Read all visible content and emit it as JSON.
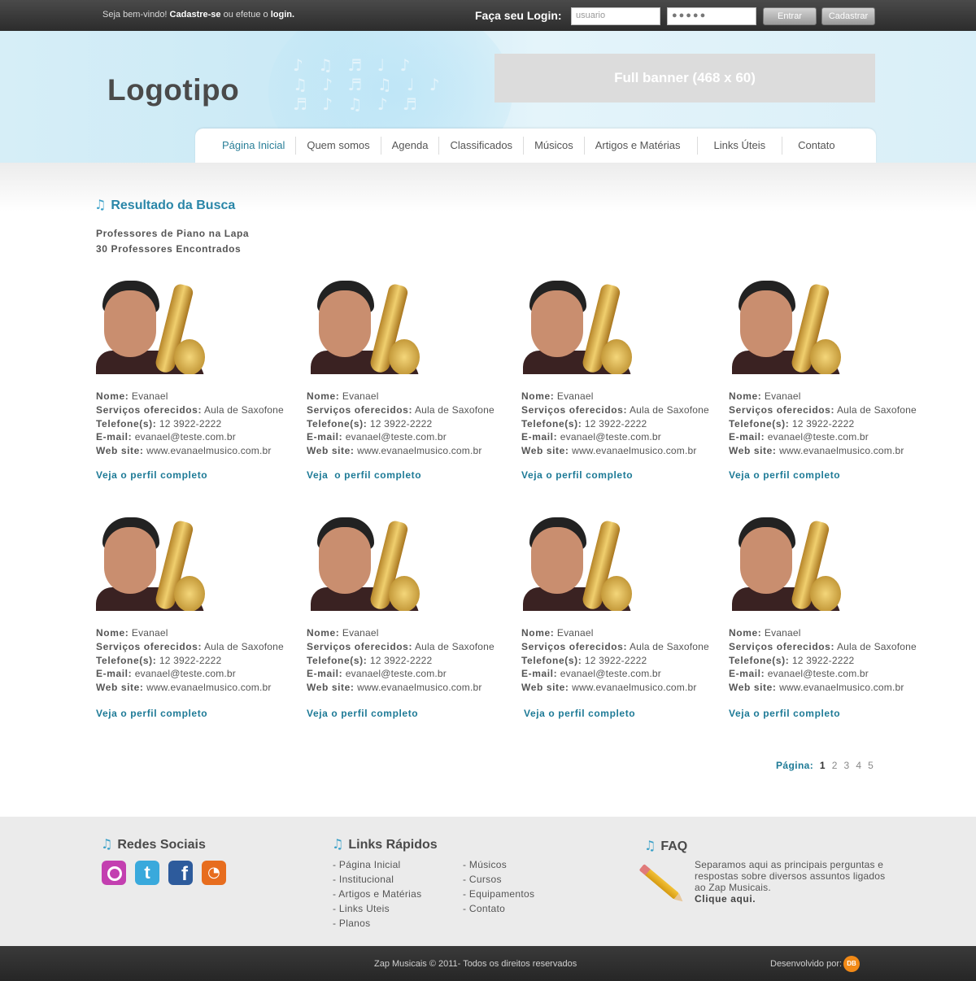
{
  "topbar": {
    "welcome_prefix": "Seja bem-vindo! ",
    "register_link": "Cadastre-se",
    "welcome_middle": " ou efetue o ",
    "login_link": "login.",
    "login_label": "Faça seu Login:",
    "username_placeholder": "usuario",
    "password_value": "●●●●●",
    "enter_button": "Entrar",
    "register_button": "Cadastrar"
  },
  "header": {
    "logo": "Logotipo",
    "banner": "Full banner (468 x 60)"
  },
  "nav": {
    "items": [
      "Página Inicial",
      "Quem somos",
      "Agenda",
      "Classificados",
      "Músicos",
      "Artigos e Matérias",
      "Links Úteis",
      "Contato"
    ],
    "active": "Página Inicial"
  },
  "search": {
    "title": "Resultado da Busca",
    "query_line": "Professores de Piano na Lapa",
    "count_line": "30 Professores Encontrados"
  },
  "labels": {
    "name": "Nome:",
    "services": "Serviços oferecidos:",
    "phone": "Telefone(s):",
    "email": "E-mail:",
    "website": "Web site:"
  },
  "results": [
    {
      "name": "Evanael",
      "services": "Aula de Saxofone",
      "phone": "12 3922-2222",
      "email": "evanael@teste.com.br",
      "website": "www.evanaelmusico.com.br",
      "link": "Veja o perfil completo"
    },
    {
      "name": "Evanael",
      "services": "Aula de Saxofone",
      "phone": "12 3922-2222",
      "email": "evanael@teste.com.br",
      "website": "www.evanaelmusico.com.br",
      "link": "Veja  o perfil completo"
    },
    {
      "name": "Evanael",
      "services": "Aula de Saxofone",
      "phone": "12 3922-2222",
      "email": "evanael@teste.com.br",
      "website": "www.evanaelmusico.com.br",
      "link": "Veja o perfil completo"
    },
    {
      "name": "Evanael",
      "services": "Aula de Saxofone",
      "phone": "12 3922-2222",
      "email": "evanael@teste.com.br",
      "website": "www.evanaelmusico.com.br",
      "link": "Veja o perfil completo"
    },
    {
      "name": "Evanael",
      "services": "Aula de Saxofone",
      "phone": "12 3922-2222",
      "email": "evanael@teste.com.br",
      "website": "www.evanaelmusico.com.br",
      "link": "Veja o perfil completo"
    },
    {
      "name": "Evanael",
      "services": "Aula de Saxofone",
      "phone": "12 3922-2222",
      "email": "evanael@teste.com.br",
      "website": "www.evanaelmusico.com.br",
      "link": "Veja o perfil completo"
    },
    {
      "name": "Evanael",
      "services": "Aula de Saxofone",
      "phone": "12 3922-2222",
      "email": "evanael@teste.com.br",
      "website": "www.evanaelmusico.com.br",
      "link": "Veja o perfil completo"
    },
    {
      "name": "Evanael",
      "services": "Aula de Saxofone",
      "phone": "12 3922-2222",
      "email": "evanael@teste.com.br",
      "website": "www.evanaelmusico.com.br",
      "link": "Veja o perfil completo"
    }
  ],
  "pagination": {
    "label": "Página:",
    "current": "1",
    "pages": [
      "2",
      "3",
      "4",
      "5"
    ]
  },
  "footer": {
    "social_title": "Redes Sociais",
    "social_icons": [
      "orkut-icon",
      "twitter-icon",
      "facebook-icon",
      "rss-icon"
    ],
    "links_title": "Links Rápidos",
    "links_col1": [
      "- Página Inicial",
      "- Institucional",
      "- Artigos e Matérias",
      "- Links Uteis",
      "- Planos"
    ],
    "links_col2": [
      "- Músicos",
      "- Cursos",
      "- Equipamentos",
      "- Contato"
    ],
    "faq_title": "FAQ",
    "faq_text": "Separamos aqui as principais perguntas e respostas sobre diversos assuntos ligados ao Zap Musicais.",
    "faq_link": "Clique aqui.",
    "copyright": "Zap Musicais © 2011- Todos os direitos reservados",
    "developed_by": "Desenvolvido por:",
    "dev_logo_text": "DB"
  },
  "colors": {
    "accent": "#2a86a8",
    "link": "#1d7a96",
    "header_bg": "#d6eef7",
    "topbar_bg": "#2c2c2c"
  }
}
